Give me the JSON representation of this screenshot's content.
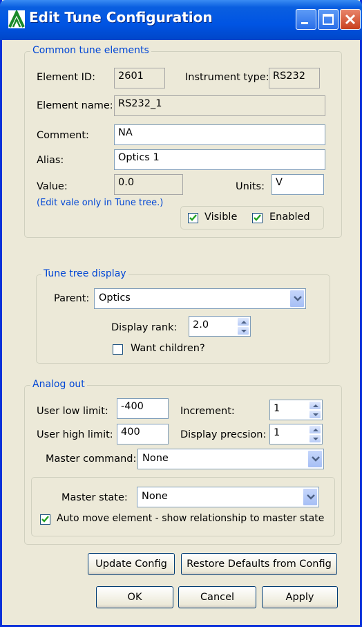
{
  "window": {
    "title": "Edit Tune Configuration"
  },
  "common": {
    "legend": "Common tune elements",
    "element_id_label": "Element ID:",
    "element_id": "2601",
    "instrument_type_label": "Instrument type:",
    "instrument_type": "RS232",
    "element_name_label": "Element name:",
    "element_name": "RS232_1",
    "comment_label": "Comment:",
    "comment": "NA",
    "alias_label": "Alias:",
    "alias": "Optics 1",
    "value_label": "Value:",
    "value": "0.0",
    "units_label": "Units:",
    "units": "V",
    "note": "(Edit vale only in Tune tree.)",
    "visible_label": "Visible",
    "visible_checked": true,
    "enabled_label": "Enabled",
    "enabled_checked": true
  },
  "tree": {
    "legend": "Tune tree display",
    "parent_label": "Parent:",
    "parent": "Optics",
    "rank_label": "Display rank:",
    "rank": "2.0",
    "want_children_label": "Want children?",
    "want_children_checked": false
  },
  "analog": {
    "legend": "Analog out",
    "low_label": "User low limit:",
    "low": "-400",
    "high_label": "User high limit:",
    "high": "400",
    "increment_label": "Increment:",
    "increment": "1",
    "precision_label": "Display precsion:",
    "precision": "1",
    "master_command_label": "Master command:",
    "master_command": "None",
    "master_state_label": "Master state:",
    "master_state": "None",
    "auto_move_label": "Auto move element - show relationship to master state",
    "auto_move_checked": true
  },
  "buttons": {
    "update": "Update Config",
    "restore": "Restore Defaults from Config",
    "ok": "OK",
    "cancel": "Cancel",
    "apply": "Apply"
  },
  "colors": {
    "titlebar": "#0054e3",
    "legend_text": "#0046d5",
    "dialog_bg": "#ece9d8"
  }
}
